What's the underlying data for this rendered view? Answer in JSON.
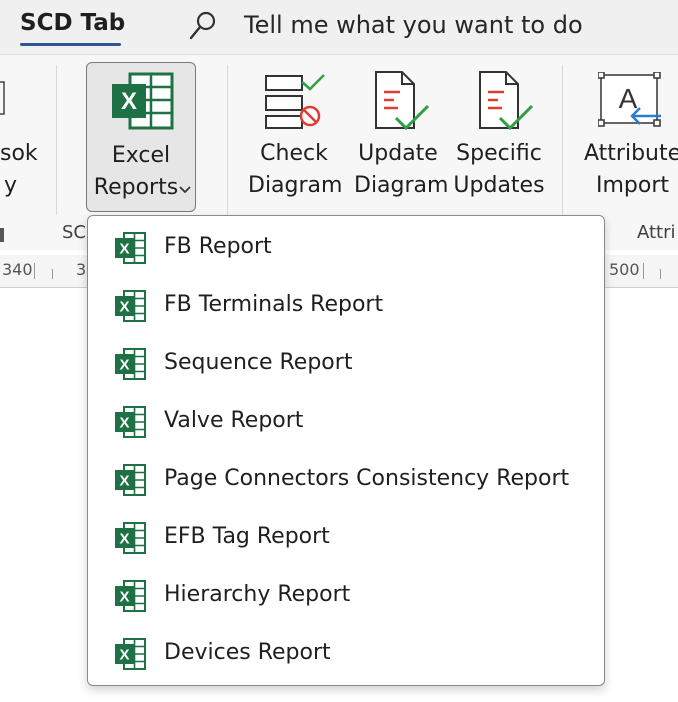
{
  "tabs": {
    "active_tab": "SCD Tab"
  },
  "search": {
    "placeholder_text": "Tell me what you want to do"
  },
  "ribbon": {
    "partial_left_label_1": "sok",
    "partial_left_label_2": "y",
    "excel_reports": {
      "line1": "Excel",
      "line2": "Reports",
      "chevron": "›"
    },
    "check_diagram": {
      "line1": "Check",
      "line2": "Diagram"
    },
    "update_diagram": {
      "line1": "Update",
      "line2": "Diagram"
    },
    "specific_updates": {
      "line1": "Specific",
      "line2": "Updates"
    },
    "attribute_import": {
      "line1": "Attribute",
      "line2": "Import"
    },
    "group_label_scd": "SC",
    "group_label_attr": "Attri"
  },
  "ruler": {
    "left_num": "340",
    "mid_num": "3",
    "right_num": "500"
  },
  "menu": {
    "items": [
      {
        "label": "FB Report",
        "icon": "excel-icon"
      },
      {
        "label": "FB Terminals Report",
        "icon": "excel-icon"
      },
      {
        "label": "Sequence Report",
        "icon": "excel-icon"
      },
      {
        "label": "Valve Report",
        "icon": "excel-icon"
      },
      {
        "label": "Page Connectors Consistency Report",
        "icon": "excel-icon"
      },
      {
        "label": "EFB Tag Report",
        "icon": "excel-icon"
      },
      {
        "label": "Hierarchy Report",
        "icon": "excel-icon"
      },
      {
        "label": "Devices Report",
        "icon": "excel-icon"
      }
    ]
  },
  "colors": {
    "accent": "#2b5797",
    "excel_green": "#1e7145",
    "check_green": "#2ea043",
    "error_red": "#e03c31"
  }
}
